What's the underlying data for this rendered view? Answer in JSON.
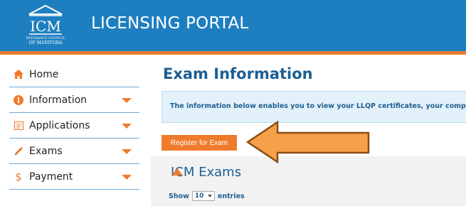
{
  "header": {
    "logo_text_main": "ICM",
    "logo_text_sub1": "INSURANCE COUNCIL",
    "logo_text_sub2": "OF MANITOBA",
    "title": "LICENSING PORTAL",
    "bg_color": "#1e7fc0",
    "accent_color": "#f07b2c"
  },
  "sidebar": {
    "items": [
      {
        "label": "Home",
        "icon": "home-icon"
      },
      {
        "label": "Information",
        "icon": "info-icon"
      },
      {
        "label": "Applications",
        "icon": "applications-icon"
      },
      {
        "label": "Exams",
        "icon": "pencil-icon"
      },
      {
        "label": "Payment",
        "icon": "dollar-icon"
      }
    ]
  },
  "main": {
    "title": "Exam Information",
    "info_text": "The information below enables you to view your LLQP certificates, your completed",
    "register_button": "Register for Exam",
    "panel_title": "ICM Exams",
    "show_label": "Show",
    "entries_value": "10",
    "entries_label": "entries"
  }
}
